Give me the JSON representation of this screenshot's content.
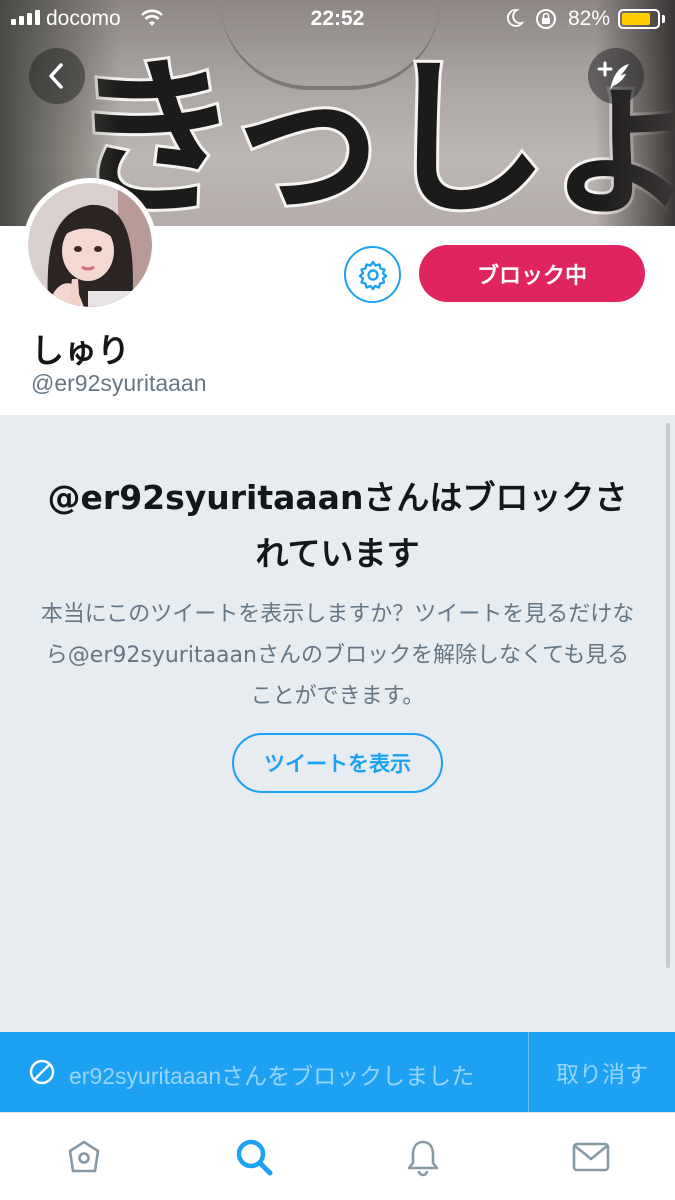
{
  "status_bar": {
    "carrier": "docomo",
    "time": "22:52",
    "battery_percent": "82%",
    "battery_level": 0.82
  },
  "header": {
    "banner_text": "きっしょ。",
    "back_icon": "chevron-left-icon",
    "compose_icon": "compose-tweet-icon"
  },
  "profile": {
    "display_name": "しゅり",
    "handle": "@er92syuritaaan",
    "settings_icon": "gear-icon",
    "blocking_label": "ブロック中"
  },
  "blocked_notice": {
    "title": "@er92syuritaaanさんはブロックされています",
    "description": "本当にこのツイートを表示しますか？ツイートを見るだけなら@er92syuritaaanさんのブロックを解除しなくても見ることができます。",
    "view_button": "ツイートを表示"
  },
  "snackbar": {
    "message": "er92syuritaaanさんをブロックしました",
    "undo_label": "取り消す"
  },
  "tabbar": {
    "items": [
      {
        "name": "home",
        "icon": "home-icon",
        "active": false
      },
      {
        "name": "search",
        "icon": "search-icon",
        "active": true
      },
      {
        "name": "notifications",
        "icon": "bell-icon",
        "active": false
      },
      {
        "name": "messages",
        "icon": "envelope-icon",
        "active": false
      }
    ]
  },
  "colors": {
    "twitter_blue": "#1da1f2",
    "blocking_red": "#e0245e",
    "panel_gray": "#e6ecf0",
    "secondary_text": "#657786"
  }
}
